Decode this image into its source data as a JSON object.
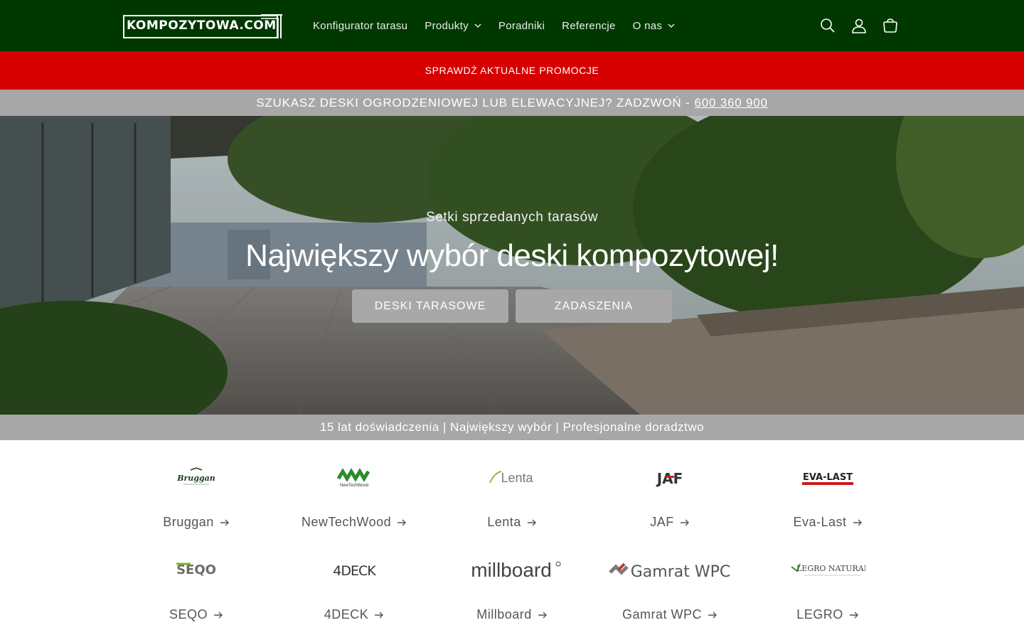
{
  "header": {
    "logo_text": "KOMPOZYTOWA.COM",
    "nav": [
      {
        "label": "Konfigurator tarasu",
        "dropdown": false
      },
      {
        "label": "Produkty",
        "dropdown": true
      },
      {
        "label": "Poradniki",
        "dropdown": false
      },
      {
        "label": "Referencje",
        "dropdown": false
      },
      {
        "label": "O nas",
        "dropdown": true
      }
    ],
    "icons": [
      "search-icon",
      "account-icon",
      "cart-icon"
    ],
    "colors": {
      "background": "#003800"
    }
  },
  "promo": {
    "text": "SPRAWDŹ AKTUALNE PROMOCJE",
    "color": "#d60000"
  },
  "phonebar": {
    "text": "SZUKASZ DESKI OGRODZENIOWEJ LUB ELEWACYJNEJ? ZADZWOŃ -",
    "phone": "600 360 900"
  },
  "hero": {
    "subtitle": "Setki sprzedanych tarasów",
    "title": "Największy wybór deski kompozytowej!",
    "buttons": [
      "DESKI TARASOWE",
      "ZADASZENIA"
    ]
  },
  "infobar": {
    "text": "15 lat doświadczenia | Największy wybór | Profesjonalne doradztwo"
  },
  "brands": [
    {
      "name": "Bruggan",
      "logo_text": "Bruggan"
    },
    {
      "name": "NewTechWood",
      "logo_text": "NewTechWood"
    },
    {
      "name": "Lenta",
      "logo_text": "Lenta"
    },
    {
      "name": "JAF",
      "logo_text": "JAF"
    },
    {
      "name": "Eva-Last",
      "logo_text": "EVA-LAST"
    },
    {
      "name": "SEQO",
      "logo_text": "SEQO"
    },
    {
      "name": "4DECK",
      "logo_text": "4DECK"
    },
    {
      "name": "Millboard",
      "logo_text": "millboard"
    },
    {
      "name": "Gamrat WPC",
      "logo_text": "Gamrat WPC"
    },
    {
      "name": "LEGRO",
      "logo_text": "LEGRO NATURAL"
    }
  ]
}
